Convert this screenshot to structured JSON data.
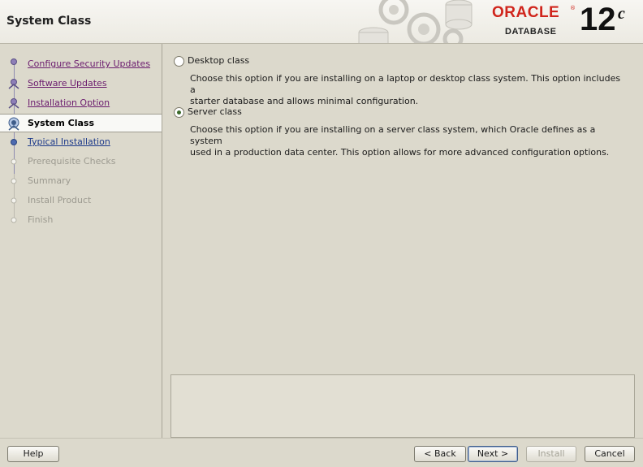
{
  "header": {
    "title": "System Class",
    "brand": {
      "name": "ORACLE",
      "registered_mark": "®",
      "product": "DATABASE",
      "version": "12",
      "version_suffix": "c"
    }
  },
  "steps": [
    {
      "label": "Configure Security Updates",
      "state": "done"
    },
    {
      "label": "Software Updates",
      "state": "done"
    },
    {
      "label": "Installation Option",
      "state": "done"
    },
    {
      "label": "System Class",
      "state": "current"
    },
    {
      "label": "Typical Installation",
      "state": "link"
    },
    {
      "label": "Prerequisite Checks",
      "state": "pending"
    },
    {
      "label": "Summary",
      "state": "pending"
    },
    {
      "label": "Install Product",
      "state": "pending"
    },
    {
      "label": "Finish",
      "state": "pending"
    }
  ],
  "options": [
    {
      "label": "Desktop class",
      "selected": false,
      "description_lines": [
        "Choose this option if you are installing on a laptop or desktop class system. This option includes a",
        "starter database and allows minimal configuration."
      ]
    },
    {
      "label": "Server class",
      "selected": true,
      "description_lines": [
        "Choose this option if you are installing on a server class system, which Oracle defines as a system",
        "used in a production data center. This option allows for more advanced configuration options."
      ]
    }
  ],
  "buttons": {
    "help": "Help",
    "back": "< Back",
    "next": "Next >",
    "install": "Install",
    "cancel": "Cancel"
  },
  "colors": {
    "background": "#dcd9cc",
    "completed_link": "#6b1c6e",
    "next_link": "#1d3a8a",
    "oracle_red": "#d0251c"
  }
}
